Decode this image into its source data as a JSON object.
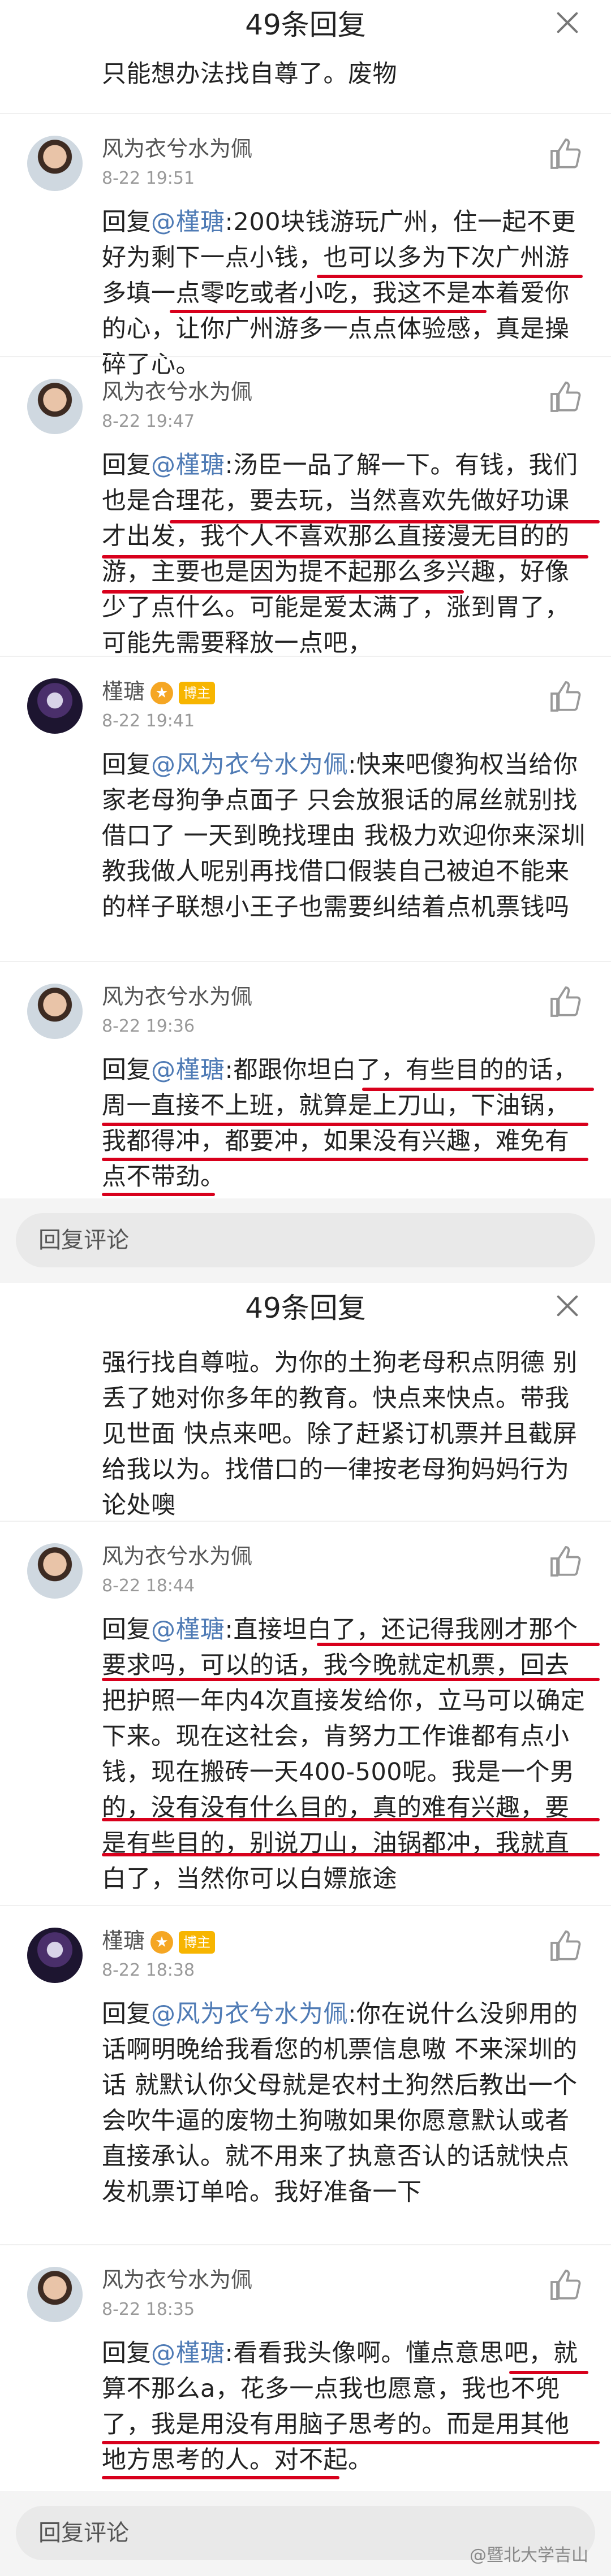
{
  "panels": [
    {
      "header_title": "49条回复",
      "top_text": "只能想办法找自尊了。废物",
      "comments": [
        {
          "author": "风为衣兮水为佩",
          "time": "8-22 19:51",
          "body_prefix": "回复",
          "mention": "@槿瑭",
          "body": ":200块钱游玩广州，住一起不更好为剩下一点小钱，也可以多为下次广州游多填一点零吃或者小吃，我这不是本着爱你的心，让你广州游多一点点体验感，真是操碎了心。"
        },
        {
          "author": "风为衣兮水为佩",
          "time": "8-22 19:47",
          "body_prefix": "回复",
          "mention": "@槿瑭",
          "body": ":汤臣一品了解一下。有钱，我们也是合理花，要去玩，当然喜欢先做好功课才出发，我个人不喜欢那么直接漫无目的的游，主要也是因为提不起那么多兴趣，好像少了点什么。可能是爱太满了，涨到胃了，可能先需要释放一点吧，"
        },
        {
          "author": "槿瑭",
          "time": "8-22 19:41",
          "badge": "博主",
          "body_prefix": "回复",
          "mention": "@风为衣兮水为佩",
          "body": ":快来吧傻狗权当给你家老母狗争点面子 只会放狠话的屌丝就别找借口了 一天到晚找理由 我极力欢迎你来深圳教我做人呢别再找借口假装自己被迫不能来的样子联想小王子也需要纠结着点机票钱吗"
        },
        {
          "author": "风为衣兮水为佩",
          "time": "8-22 19:36",
          "body_prefix": "回复",
          "mention": "@槿瑭",
          "body": ":都跟你坦白了，有些目的的话，周一直接不上班，就算是上刀山，下油锅，我都得冲，都要冲，如果没有兴趣，难免有点不带劲。"
        }
      ],
      "reply_placeholder": "回复评论"
    },
    {
      "header_title": "49条回复",
      "top_text": "强行找自尊啦。为你的土狗老母积点阴德 别丢了她对你多年的教育。快点来快点。带我见世面 快点来吧。除了赶紧订机票并且截屏给我以为。找借口的一律按老母狗妈妈行为论处噢",
      "comments": [
        {
          "author": "风为衣兮水为佩",
          "time": "8-22 18:44",
          "body_prefix": "回复",
          "mention": "@槿瑭",
          "body": ":直接坦白了，还记得我刚才那个要求吗，可以的话，我今晚就定机票，回去把护照一年内4次直接发给你，立马可以确定下来。现在这社会，肯努力工作谁都有点小钱，现在搬砖一天400-500呢。我是一个男的，没有没有什么目的，真的难有兴趣，要是有些目的，别说刀山，油锅都冲，我就直白了，当然你可以白嫖旅途"
        },
        {
          "author": "槿瑭",
          "time": "8-22 18:38",
          "badge": "博主",
          "body_prefix": "回复",
          "mention": "@风为衣兮水为佩",
          "body": ":你在说什么没卵用的话啊明晚给我看您的机票信息嗷 不来深圳的话 就默认你父母就是农村土狗然后教出一个会吹牛逼的废物土狗嗷如果你愿意默认或者直接承认。就不用来了执意否认的话就快点发机票订单哈。我好准备一下"
        },
        {
          "author": "风为衣兮水为佩",
          "time": "8-22 18:35",
          "body_prefix": "回复",
          "mention": "@槿瑭",
          "body": ":看看我头像啊。懂点意思吧，就算不那么a，花多一点我也愿意，我也不兜了，我是用没有用脑子思考的。而是用其他地方思考的人。对不起。"
        }
      ],
      "reply_placeholder": "回复评论",
      "watermark": "@暨北大学吉山"
    }
  ]
}
